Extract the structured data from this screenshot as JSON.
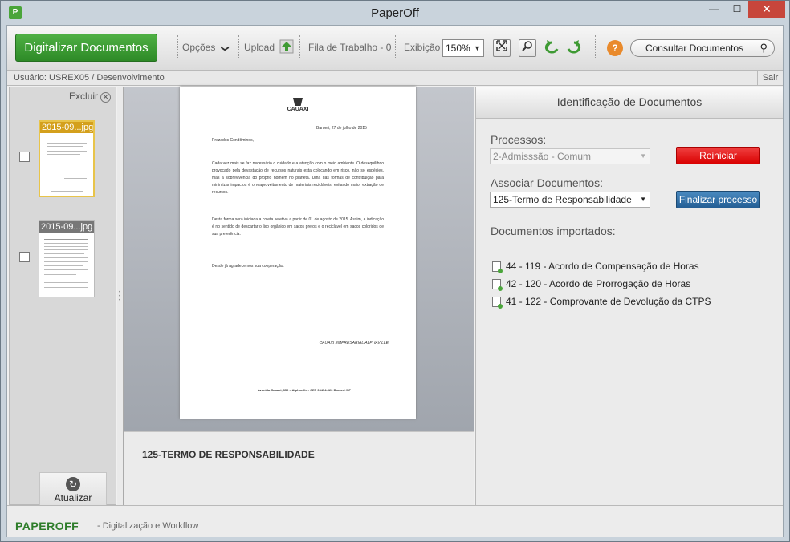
{
  "window": {
    "title": "PaperOff",
    "app_icon": "P",
    "min": "—",
    "max": "☐",
    "close": "✕"
  },
  "toolbar": {
    "digitalizar_label": "Digitalizar Documentos",
    "opcoes_label": "Opções",
    "opcoes_chevron": "❯",
    "upload_label": "Upload",
    "fila_label": "Fila de Trabalho - 0",
    "exibicao_label": "Exibição",
    "zoom_value": "150%",
    "consultar_label": "Consultar Documentos"
  },
  "userbar": {
    "user": "Usuário: USREX05 / Desenvolvimento",
    "logout": "Sair"
  },
  "sidebar": {
    "excluir_label": "Excluir",
    "thumbnails": [
      {
        "label": "2015-09...jpg",
        "selected": true
      },
      {
        "label": "2015-09...jpg",
        "selected": false
      }
    ],
    "refresh_label": "Atualizar"
  },
  "document": {
    "company": "CAUAXI",
    "date_line": "Barueri, 27 de julho de 2015",
    "greeting": "Prezados Condôminos,",
    "para1": "Cada vez mais se faz necessário o cuidado e a atenção com o meio ambiente. O desequilíbrio provocado pela devastação de recursos naturais esta colocando em risco, não só espécies, mas a sobrevivência do próprio homem no planeta. Uma das formas de contribuição para minimizar impactos é o reaproveitamento de materiais recicláveis, evitando maior extração de recursos.",
    "para2": "Desta forma será iniciada a coleta seletiva a partir de 01 de agosto de 2015. Assim, a indicação é no sentido de descartar o lixo orgânico em sacos pretos e o reciclável em sacos coloridos de sua preferência.",
    "closing": "Desde já agradecemos sua cooperação.",
    "signature": "CAUAXI EMPRESARIAL ALPHAVILLE",
    "footer": "Avenida Cauaxi, 350 – Alphaville - CEP 06454-020 Barueri /SP"
  },
  "docname": "125-TERMO DE RESPONSABILIDADE",
  "panel": {
    "header": "Identificação de Documentos",
    "processos_label": "Processos:",
    "processos_value": "2-Admisssão - Comum",
    "reiniciar_label": "Reiniciar",
    "associar_label": "Associar Documentos:",
    "associar_value": "125-Termo de Responsabilidade",
    "finalizar_label": "Finalizar processo",
    "importados_label": "Documentos importados:",
    "importados": [
      "44 - 119 - Acordo de Compensação de Horas",
      "42 - 120 - Acordo de Prorrogação de Horas",
      "41 - 122 - Comprovante de Devolução da CTPS"
    ]
  },
  "footer": {
    "brand": "PAPEROFF",
    "subtitle": "- Digitalização e Workflow"
  }
}
